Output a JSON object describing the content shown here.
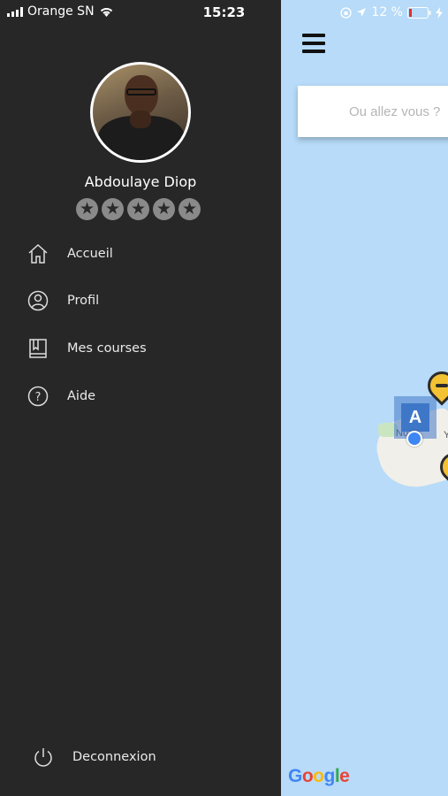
{
  "status_bar": {
    "carrier": "Orange SN",
    "time": "15:23",
    "battery": "12 %"
  },
  "user": {
    "name": "Abdoulaye Diop",
    "rating": 0,
    "max_rating": 5
  },
  "menu": {
    "items": [
      {
        "label": "Accueil",
        "icon": "home-icon"
      },
      {
        "label": "Profil",
        "icon": "user-icon"
      },
      {
        "label": "Mes courses",
        "icon": "book-icon"
      },
      {
        "label": "Aide",
        "icon": "help-icon"
      }
    ],
    "logout_label": "Deconnexion"
  },
  "map": {
    "search_placeholder": "Ou allez vous ?",
    "marker_label": "A",
    "label_left": "No",
    "label_right": "Y",
    "attribution": "Google"
  },
  "colors": {
    "drawer_bg": "#272727",
    "map_water": "#b7dbf8",
    "marker_blue": "#3f77c8",
    "taxi_yellow": "#f2c233"
  }
}
